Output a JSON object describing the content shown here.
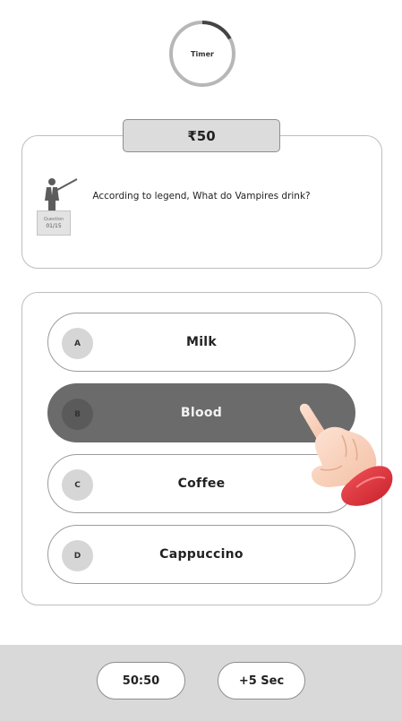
{
  "timer": {
    "label": "Timer",
    "progress": 0.17
  },
  "prize": {
    "label": "₹50"
  },
  "question": {
    "counter_label": "Question",
    "counter": "01/15",
    "text": "According to legend, What do Vampires drink?"
  },
  "options": [
    {
      "letter": "A",
      "label": "Milk",
      "selected": false
    },
    {
      "letter": "B",
      "label": "Blood",
      "selected": true
    },
    {
      "letter": "C",
      "label": "Coffee",
      "selected": false
    },
    {
      "letter": "D",
      "label": "Cappuccino",
      "selected": false
    }
  ],
  "lifelines": {
    "fifty_fifty": "50:50",
    "extra_time": "+5 Sec"
  },
  "colors": {
    "accent_dark": "#6b6b6b",
    "surface": "#d9d9d9",
    "cuff": "#e0313a"
  },
  "icons": {
    "presenter": "teacher-pointing-board-icon",
    "hand": "pointing-hand-icon"
  }
}
